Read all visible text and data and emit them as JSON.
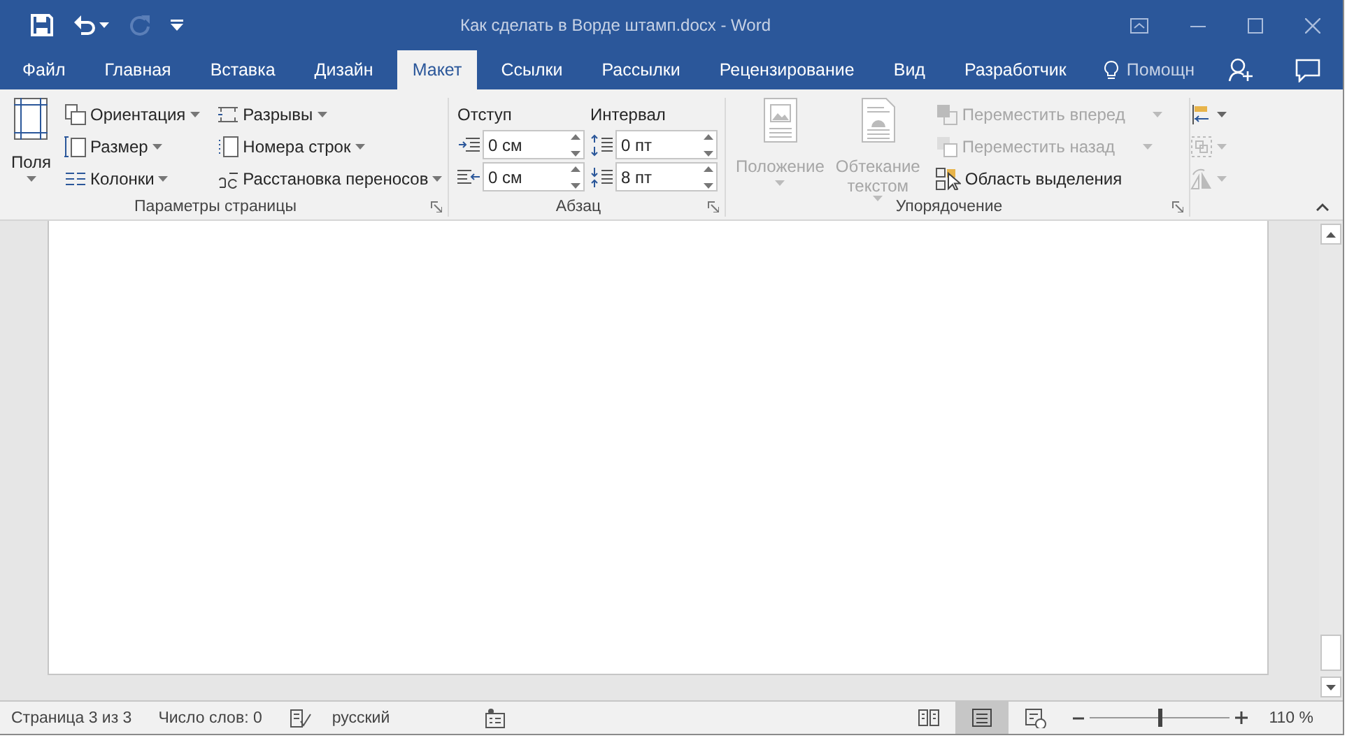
{
  "title_bar": {
    "quick_access": [
      {
        "kind": "save",
        "disabled": false
      },
      {
        "kind": "undo",
        "disabled": false
      },
      {
        "kind": "redo",
        "disabled": true
      },
      {
        "kind": "customize",
        "disabled": false
      }
    ],
    "title": "Как сделать в Ворде штамп.docx - Word"
  },
  "tabs": [
    {
      "label": "Файл",
      "selected": false
    },
    {
      "label": "Главная",
      "selected": false
    },
    {
      "label": "Вставка",
      "selected": false
    },
    {
      "label": "Дизайн",
      "selected": false
    },
    {
      "label": "Макет",
      "selected": true
    },
    {
      "label": "Ссылки",
      "selected": false
    },
    {
      "label": "Рассылки",
      "selected": false
    },
    {
      "label": "Рецензирование",
      "selected": false
    },
    {
      "label": "Вид",
      "selected": false
    },
    {
      "label": "Разработчик",
      "selected": false
    }
  ],
  "help": {
    "label": "Помощн"
  },
  "ribbon": {
    "page_setup": {
      "title": "Параметры страницы",
      "margins": {
        "label": "Поля"
      },
      "items": [
        {
          "label": "Ориентация"
        },
        {
          "label": "Размер"
        },
        {
          "label": "Колонки"
        },
        {
          "label": "Разрывы"
        },
        {
          "label": "Номера строк"
        },
        {
          "label": "Расстановка переносов"
        }
      ]
    },
    "paragraph": {
      "title": "Абзац",
      "indent": {
        "label": "Отступ",
        "fields": [
          {
            "value": "0 см"
          },
          {
            "value": "0 см"
          }
        ]
      },
      "spacing": {
        "label": "Интервал",
        "fields": [
          {
            "value": "0 пт"
          },
          {
            "value": "8 пт"
          }
        ]
      }
    },
    "arrange": {
      "title": "Упорядочение",
      "large": [
        {
          "label": "Положение",
          "disabled": true
        },
        {
          "label": "Обтекание текстом",
          "disabled": true
        }
      ],
      "items": [
        {
          "label": "Переместить вперед",
          "disabled": true
        },
        {
          "label": "Переместить назад",
          "disabled": true
        },
        {
          "label": "Область выделения",
          "disabled": false
        }
      ],
      "icon_buttons": [
        {
          "disabled": false
        },
        {
          "disabled": true
        },
        {
          "disabled": true
        }
      ]
    }
  },
  "status_bar": {
    "page": "Страница 3 из 3",
    "words": "Число слов: 0",
    "language": "русский",
    "views": [
      {
        "selected": false
      },
      {
        "selected": true
      },
      {
        "selected": false
      }
    ],
    "zoom": {
      "level": 0.5,
      "reading": "110 %"
    }
  }
}
